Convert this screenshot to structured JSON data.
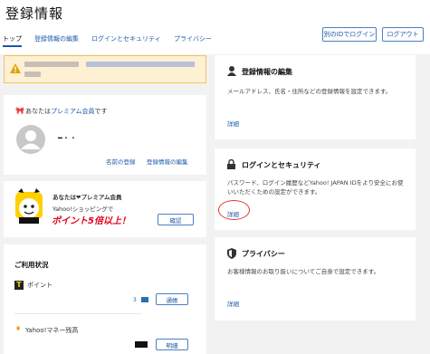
{
  "header": {
    "title": "登録情報",
    "tabs": [
      "トップ",
      "登録情報の編集",
      "ログインとセキュリティ",
      "プライバシー"
    ],
    "login_other": "別のIDでログイン",
    "logout": "ログアウト"
  },
  "premium_card": {
    "text_pre": "あなたは",
    "link": "プレミアム会員",
    "text_post": "です",
    "user_name": "━・・",
    "link_name": "名前の登録",
    "link_edit": "登録情報の編集"
  },
  "promo": {
    "title": "あなたは❤プレミアム会員",
    "line1": "Yahoo!ショッピングで",
    "big": "ポイント5倍以上！",
    "button": "確認"
  },
  "usage": {
    "title": "ご利用状況",
    "points_label": "ポイント",
    "points_value": "3",
    "points_button": "通帳",
    "money_label": "Yahoo!マネー残高",
    "money_button": "明細"
  },
  "sections": [
    {
      "title": "登録情報の編集",
      "desc": "メールアドレス、氏名・住所などの登録情報を設定できます。",
      "link": "詳細"
    },
    {
      "title": "ログインとセキュリティ",
      "desc": "パスワード、ログイン履歴などYahoo! JAPAN IDをより安全にお使いいただくための設定ができます。",
      "link": "詳細"
    },
    {
      "title": "プライバシー",
      "desc": "お客様情報のお取り扱いについてご自身で設定できます。",
      "link": "詳細"
    }
  ],
  "colors": {
    "accent": "#1a5aa7",
    "highlight_circle": "#e53935",
    "alert_bg": "#fdf0d3"
  }
}
